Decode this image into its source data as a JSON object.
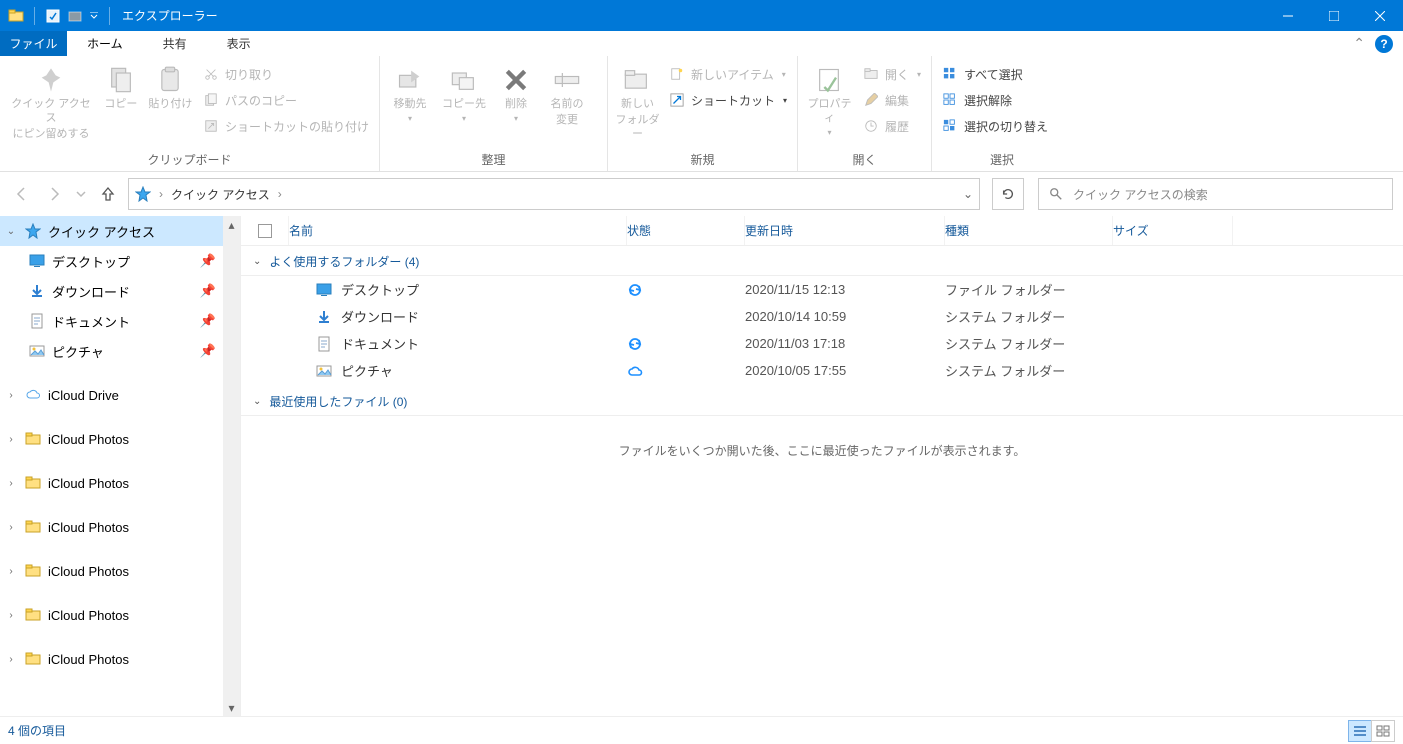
{
  "window": {
    "title": "エクスプローラー",
    "minimize": "—",
    "maximize": "☐",
    "close": "✕"
  },
  "tabs": {
    "file": "ファイル",
    "home": "ホーム",
    "share": "共有",
    "view": "表示"
  },
  "ribbon": {
    "clipboard": {
      "label": "クリップボード",
      "pin1": "クイック アクセス",
      "pin2": "にピン留めする",
      "copy": "コピー",
      "paste": "貼り付け",
      "cut": "切り取り",
      "copy_path": "パスのコピー",
      "paste_shortcut": "ショートカットの貼り付け"
    },
    "organize": {
      "label": "整理",
      "move_to": "移動先",
      "copy_to": "コピー先",
      "delete": "削除",
      "rename1": "名前の",
      "rename2": "変更"
    },
    "new": {
      "label": "新規",
      "new_folder1": "新しい",
      "new_folder2": "フォルダー",
      "new_item": "新しいアイテム",
      "shortcut": "ショートカット"
    },
    "open": {
      "label": "開く",
      "properties": "プロパティ",
      "open": "開く",
      "edit": "編集",
      "history": "履歴"
    },
    "select": {
      "label": "選択",
      "select_all": "すべて選択",
      "select_none": "選択解除",
      "invert": "選択の切り替え"
    }
  },
  "address": {
    "root": "クイック アクセス",
    "refresh": "↻"
  },
  "search": {
    "placeholder": "クイック アクセスの検索"
  },
  "navpane": {
    "quick_access": "クイック アクセス",
    "desktop": "デスクトップ",
    "downloads": "ダウンロード",
    "documents": "ドキュメント",
    "pictures": "ピクチャ",
    "icloud_drive": "iCloud Drive",
    "icloud_photos": "iCloud Photos"
  },
  "columns": {
    "name": "名前",
    "state": "状態",
    "modified": "更新日時",
    "type": "種類",
    "size": "サイズ"
  },
  "groups": {
    "freq_folders": "よく使用するフォルダー (4)",
    "recent_files": "最近使用したファイル (0)",
    "recent_hint": "ファイルをいくつか開いた後、ここに最近使ったファイルが表示されます。"
  },
  "rows": [
    {
      "name": "デスクトップ",
      "state": "sync",
      "date": "2020/11/15 12:13",
      "type": "ファイル フォルダー"
    },
    {
      "name": "ダウンロード",
      "state": "",
      "date": "2020/10/14 10:59",
      "type": "システム フォルダー"
    },
    {
      "name": "ドキュメント",
      "state": "sync",
      "date": "2020/11/03 17:18",
      "type": "システム フォルダー"
    },
    {
      "name": "ピクチャ",
      "state": "cloud",
      "date": "2020/10/05 17:55",
      "type": "システム フォルダー"
    }
  ],
  "status": {
    "count": "4 個の項目"
  }
}
